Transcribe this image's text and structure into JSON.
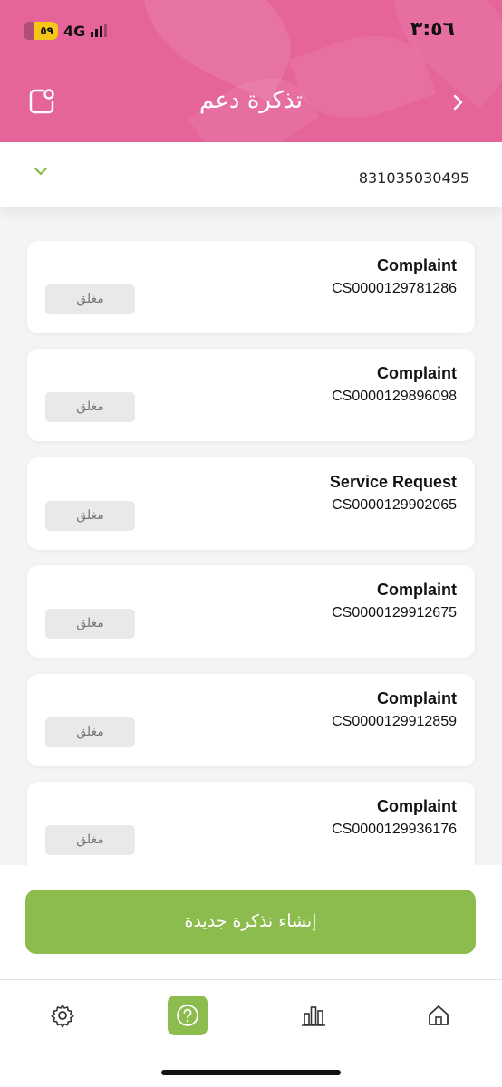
{
  "status_bar": {
    "time": "٣:٥٦",
    "battery_level": "٥٩",
    "network": "4G"
  },
  "header": {
    "title": "تذكرة دعم"
  },
  "account": {
    "number": "831035030495"
  },
  "tickets": [
    {
      "type": "Complaint",
      "id": "CS0000129781286",
      "status": "مغلق"
    },
    {
      "type": "Complaint",
      "id": "CS0000129896098",
      "status": "مغلق"
    },
    {
      "type": "Service Request",
      "id": "CS0000129902065",
      "status": "مغلق"
    },
    {
      "type": "Complaint",
      "id": "CS0000129912675",
      "status": "مغلق"
    },
    {
      "type": "Complaint",
      "id": "CS0000129912859",
      "status": "مغلق"
    },
    {
      "type": "Complaint",
      "id": "CS0000129936176",
      "status": "مغلق"
    }
  ],
  "create_button": {
    "label": "إنشاء تذكرة جديدة"
  },
  "tab_bar": {
    "items": [
      {
        "icon": "gear-icon",
        "active": false
      },
      {
        "icon": "help-icon",
        "active": true
      },
      {
        "icon": "bar-chart-icon",
        "active": false
      },
      {
        "icon": "home-icon",
        "active": false
      }
    ]
  },
  "colors": {
    "header_pink": "#e5649a",
    "accent_green": "#8cbb4e"
  }
}
